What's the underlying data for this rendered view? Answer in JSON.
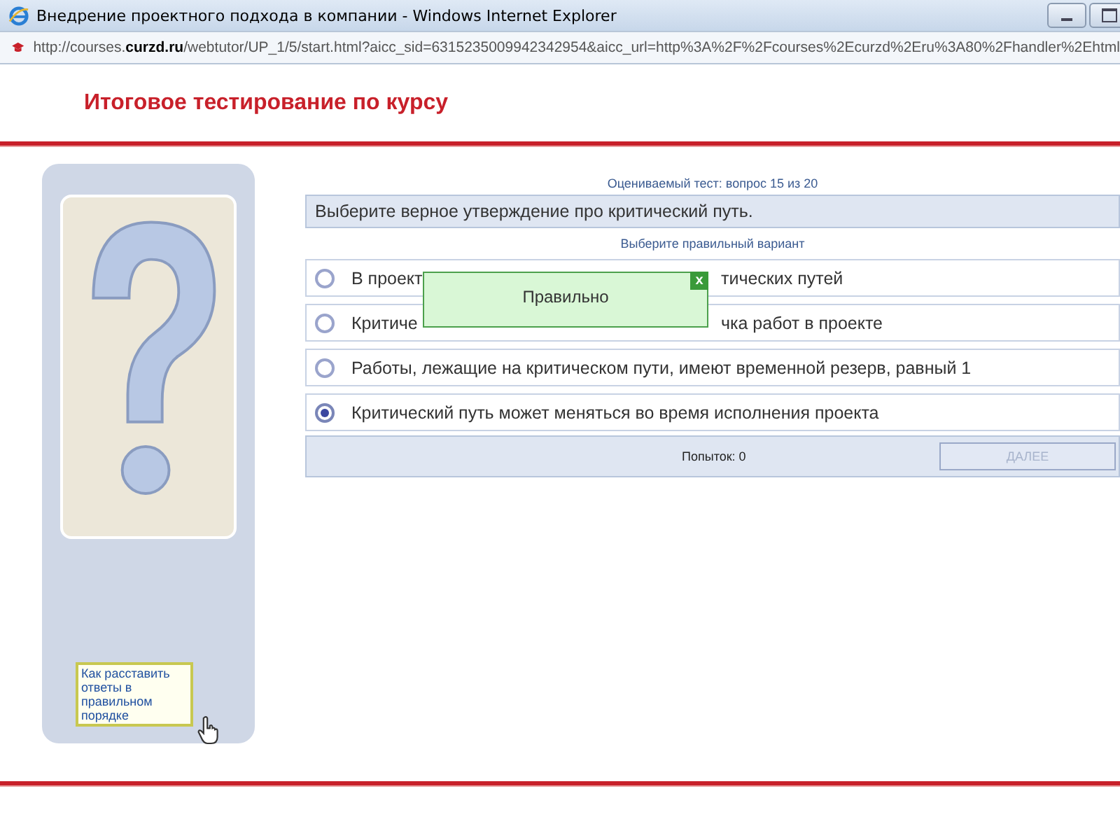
{
  "window": {
    "title": "Внедрение проектного подхода в компании - Windows Internet Explorer"
  },
  "address_bar": {
    "url_start": "http://courses.",
    "url_domain": "curzd.ru",
    "url_rest": "/webtutor/UP_1/5/start.html?aicc_sid=6315235009942342954&aicc_url=http%3A%2F%2Fcourses%2Ecurzd%2Eru%3A80%2Fhandler%2Ehtml"
  },
  "page": {
    "heading": "Итоговое тестирование по курсу"
  },
  "help_link": {
    "label": "Как расставить ответы в правильном порядке"
  },
  "test": {
    "progress": "Оцениваемый тест: вопрос 15 из 20",
    "question": "Выберите верное утверждение про критический путь.",
    "instruction": "Выберите правильный вариант",
    "options": [
      {
        "text_parts": [
          "В проект",
          "тических путей"
        ],
        "selected": false
      },
      {
        "text_parts": [
          "Критиче",
          "чка работ в проекте"
        ],
        "selected": false
      },
      {
        "text_parts": [
          "Работы, лежащие на критическом пути, имеют временной резерв, равный 1"
        ],
        "selected": false
      },
      {
        "text_parts": [
          "Критический путь может меняться во время исполнения проекта"
        ],
        "selected": true
      }
    ],
    "attempts": "Попыток: 0",
    "next_button": {
      "label": "ДАЛЕЕ",
      "disabled": true
    }
  },
  "popup": {
    "message": "Правильно",
    "close": "x"
  }
}
